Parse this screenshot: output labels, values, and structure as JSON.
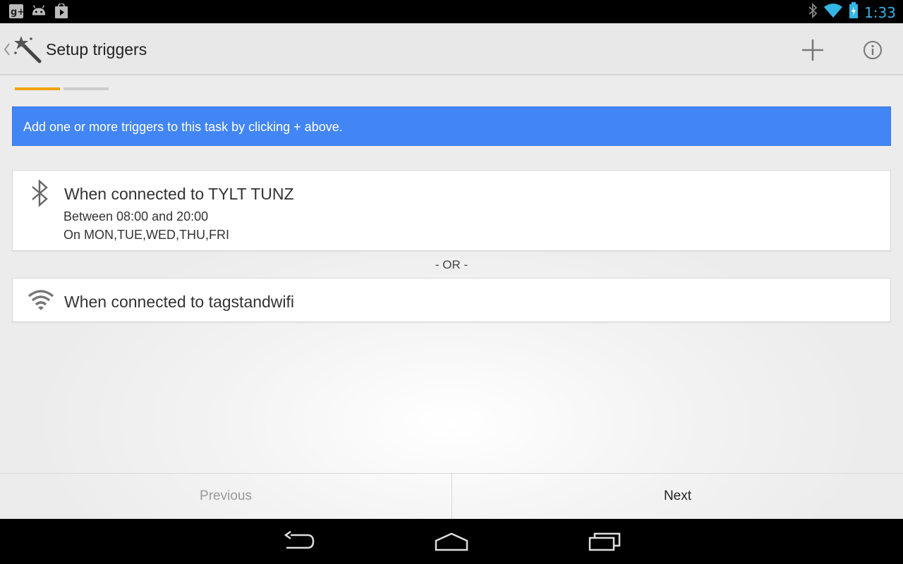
{
  "status_bar": {
    "time": "1:33",
    "left_icons": [
      "google-plus-icon",
      "android-icon",
      "play-store-icon"
    ],
    "right_icons": [
      "bluetooth-icon",
      "wifi-icon",
      "battery-charging-icon"
    ],
    "accent_color": "#33b5e5"
  },
  "action_bar": {
    "title": "Setup triggers",
    "app_icon": "magic-wand-icon",
    "actions": [
      "add-icon",
      "info-icon"
    ]
  },
  "steps": {
    "total": 2,
    "current": 1,
    "active_color": "#f0a30a"
  },
  "banner": {
    "text": "Add one or more triggers to this task by clicking + above.",
    "color": "#4285f4"
  },
  "triggers": [
    {
      "icon": "bluetooth-icon",
      "title": "When connected to TYLT TUNZ",
      "details": [
        "Between 08:00 and 20:00",
        "On MON,TUE,WED,THU,FRI"
      ]
    },
    {
      "icon": "wifi-icon",
      "title": "When connected to tagstandwifi",
      "details": []
    }
  ],
  "separator": "- OR -",
  "footer": {
    "previous_label": "Previous",
    "next_label": "Next"
  },
  "nav_bar": {
    "buttons": [
      "back-icon",
      "home-icon",
      "recent-apps-icon"
    ]
  }
}
